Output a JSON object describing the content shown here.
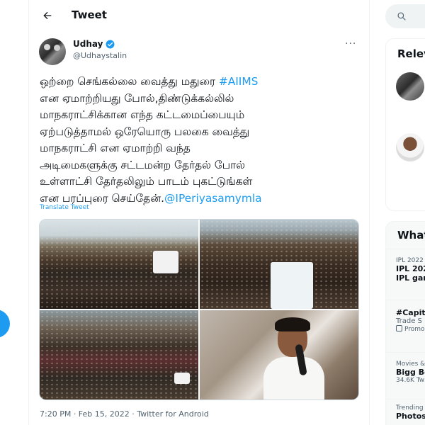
{
  "header": {
    "title": "Tweet"
  },
  "tweet": {
    "author_name": "Udhay",
    "author_handle": "@Udhaystalin",
    "more": "···",
    "text_lines": [
      {
        "before": "ஒற்றை செங்கல்லை வைத்து மதுரை ",
        "link": "#AIIMS",
        "after": ""
      },
      {
        "before": "என ஏமாற்றியது போல்,திண்டுக்கல்லில்",
        "link": "",
        "after": ""
      },
      {
        "before": "மாநகராட்சிக்கான எந்த கட்டமைப்பையும்",
        "link": "",
        "after": ""
      },
      {
        "before": "ஏற்படுத்தாமல் ஒரேயொரு பலகை வைத்து",
        "link": "",
        "after": ""
      },
      {
        "before": "மாநகராட்சி என ஏமாற்றி வந்த",
        "link": "",
        "after": ""
      },
      {
        "before": "அடிமைகளுக்கு சட்டமன்ற தேர்தல் போல்",
        "link": "",
        "after": ""
      },
      {
        "before": "உள்ளாட்சி தேர்தலிலும் பாடம் புகட்டுங்கள்",
        "link": "",
        "after": ""
      },
      {
        "before": "என பரப்புரை செய்தேன்.",
        "link": "@IPeriyasamymla",
        "after": ""
      }
    ],
    "translate": "Translate Tweet",
    "meta": "7:20 PM · Feb 15, 2022 · Twitter for Android"
  },
  "right": {
    "relevant_title": "Relev",
    "whats_title": "What",
    "trends": [
      {
        "context": "IPL 2022",
        "name": "IPL 202",
        "sub": "IPL gan"
      },
      {
        "context": "",
        "name": "#Capita",
        "sub": "Trade S",
        "promo": "Promo"
      },
      {
        "context": "Movies &",
        "name": "Bigg Bo",
        "sub": "34.6K Tw"
      },
      {
        "context": "Trending",
        "name": "Photosh",
        "sub": ""
      }
    ]
  },
  "colors": {
    "accent": "#1d9bf0",
    "text": "#0f1419",
    "muted": "#536471",
    "border": "#eff3f4"
  }
}
